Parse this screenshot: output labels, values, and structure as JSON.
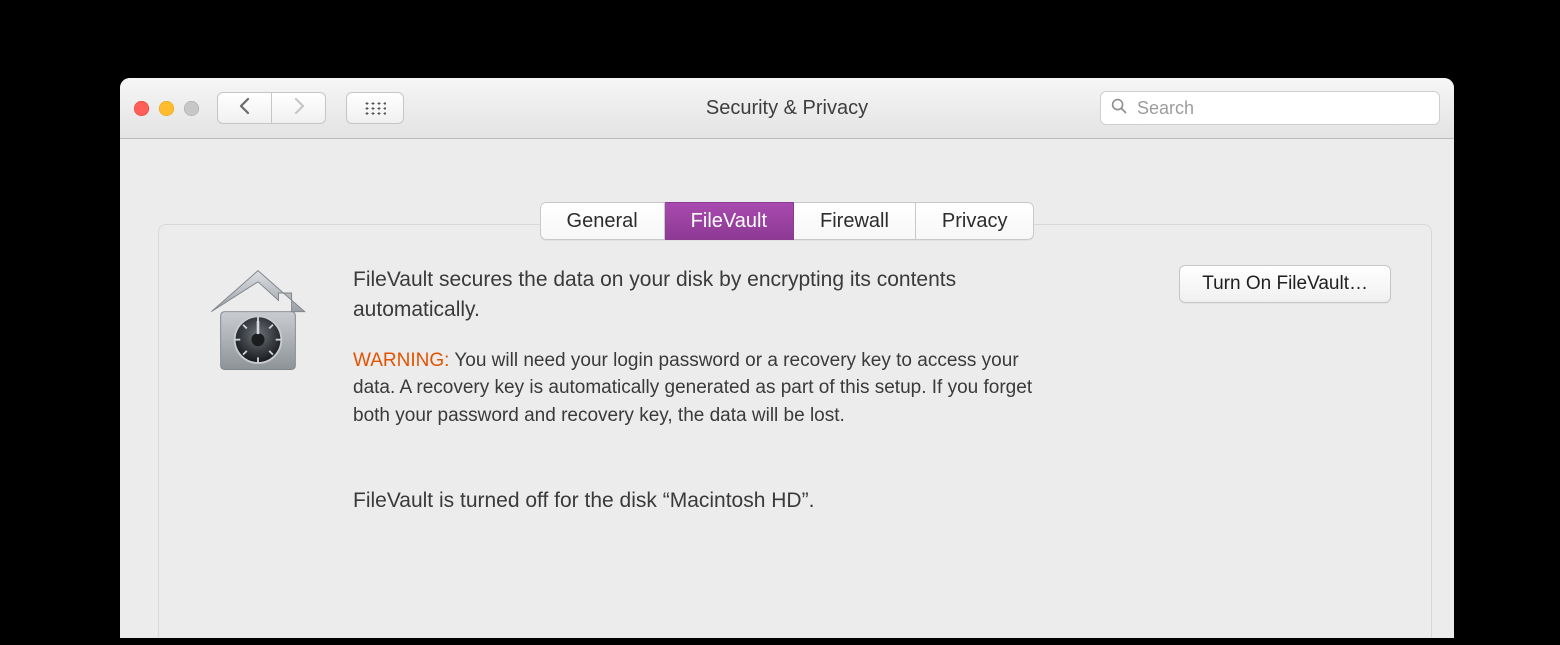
{
  "window": {
    "title": "Security & Privacy"
  },
  "search": {
    "placeholder": "Search",
    "value": ""
  },
  "tabs": {
    "items": [
      {
        "label": "General"
      },
      {
        "label": "FileVault"
      },
      {
        "label": "Firewall"
      },
      {
        "label": "Privacy"
      }
    ],
    "selected_index": 1
  },
  "filevault": {
    "description": "FileVault secures the data on your disk by encrypting its contents automatically.",
    "warning_label": "WARNING:",
    "warning_body": "You will need your login password or a recovery key to access your data. A recovery key is automatically generated as part of this setup. If you forget both your password and recovery key, the data will be lost.",
    "status": "FileVault is turned off for the disk “Macintosh HD”.",
    "action_label": "Turn On FileVault…"
  },
  "icons": {
    "back": "chevron-left-icon",
    "forward": "chevron-right-icon",
    "apps": "apps-grid-icon",
    "search": "search-icon",
    "filevault": "filevault-house-lock-icon"
  },
  "colors": {
    "accent": "#a84ab0",
    "warning": "#e25300"
  }
}
